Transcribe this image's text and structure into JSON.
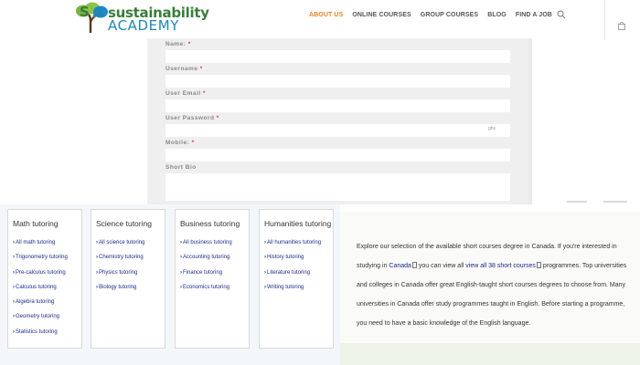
{
  "header": {
    "logo_line1": "sustainability",
    "logo_line2": "ACADEMY",
    "nav": [
      "ABOUT US",
      "ONLINE COURSES",
      "GROUP COURSES",
      "BLOG",
      "FIND A JOB"
    ],
    "active_nav": "ABOUT US",
    "search_icon": "search-icon",
    "cart_icon": "shopping-bag-icon",
    "accent_color": "#e8822a"
  },
  "form": {
    "fields": [
      {
        "label": "Name:",
        "required": true
      },
      {
        "label": "Username",
        "required": true
      },
      {
        "label": "User Email",
        "required": true
      },
      {
        "label": "User Password",
        "required": true
      },
      {
        "label": "Mobile:",
        "required": true
      },
      {
        "label": "Short Bio",
        "required": false
      }
    ],
    "password_toggle": "ghs",
    "required_mark": "*"
  },
  "tutoring": [
    {
      "title": "Math tutoring",
      "items": [
        "All math tutoring",
        "Trigonometry tutoring",
        "Pre-calculus tutoring",
        "Calculus tutoring",
        "Algebra tutoring",
        "Geometry tutoring",
        "Statistics tutoring"
      ]
    },
    {
      "title": "Science tutoring",
      "items": [
        "All science tutoring",
        "Chemistry tutoring",
        "Physics tutoring",
        "Biology tutoring"
      ]
    },
    {
      "title": "Business tutoring",
      "items": [
        "All business tutoring",
        "Accounting tutoring",
        "Finance tutoring",
        "Economics tutoring"
      ]
    },
    {
      "title": "Humanities tutoring",
      "items": [
        "All humanities tutoring",
        "History tutoring",
        "Literature tutoring",
        "Writing tutoring"
      ]
    }
  ],
  "promo": {
    "t1": "Explore our selection of the available short courses degree in Canada. If you're interested in studying in ",
    "link1": "Canada",
    "t2": " you can view all ",
    "link2": "view all 38 short courses",
    "t3": " programmes. Top universities and colleges in Canada offer great English-taught short courses degrees to choose from. Many universities in Canada offer study programmes taught in English. Before starting a programme, you need to have a basic knowledge of the English language."
  }
}
